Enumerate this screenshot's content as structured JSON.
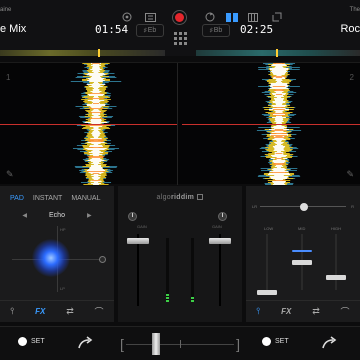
{
  "deck_left": {
    "artist": "aine",
    "title": "e Mix",
    "time": "01:54",
    "key": "Eb",
    "number": "1"
  },
  "deck_right": {
    "artist": "The",
    "title": "Roc",
    "time": "02:25",
    "key": "Bb",
    "number": "2"
  },
  "toolbar": {
    "record_color": "#e4262c",
    "icons": [
      "target-icon",
      "sliders-icon",
      "record-icon",
      "loop-icon",
      "split-layout-icon",
      "grid-view-icon",
      "expand-icon"
    ]
  },
  "fx_panel": {
    "tabs": [
      {
        "label": "PAD",
        "active": true
      },
      {
        "label": "INSTANT",
        "active": false
      },
      {
        "label": "MANUAL",
        "active": false
      }
    ],
    "effect_name": "Echo",
    "accent_color": "#3a9bff",
    "xy_labels": {
      "top": "HP",
      "bottom": "LP"
    },
    "bottom_fx_label": "FX"
  },
  "mixer": {
    "brand_prefix": "algo",
    "brand_suffix": "riddim",
    "gain_left_label": "GAIN",
    "gain_right_label": "GAIN",
    "meter_left_level": 0.12,
    "meter_right_level": 0.08
  },
  "eq_panel": {
    "top_left_tag": "LR",
    "top_right_tag": "R",
    "band_labels": [
      "LOW",
      "MID",
      "HIGH"
    ],
    "bottom_fx_label": "FX"
  },
  "bottom": {
    "set_left": "SET",
    "set_right": "SET"
  },
  "waveform_colors": {
    "low": "#e8c21c",
    "mid": "#4dd0ff",
    "high": "#ffffff",
    "accent": "#ff8a2a"
  }
}
